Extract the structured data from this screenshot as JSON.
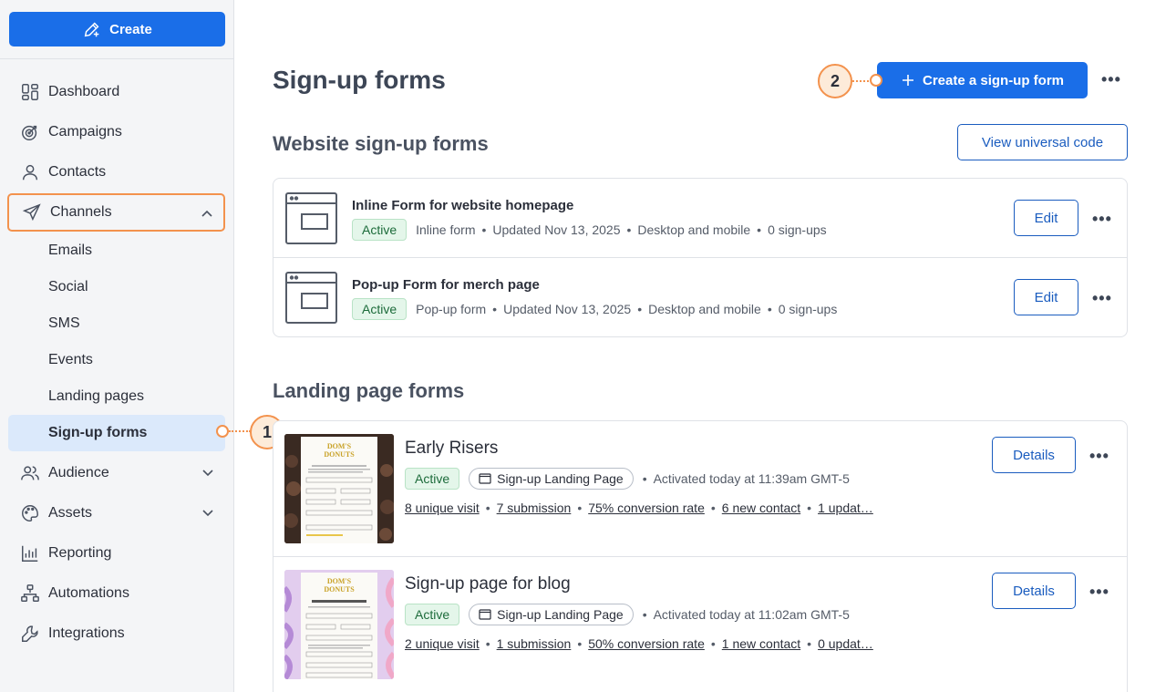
{
  "sidebar": {
    "create_label": "Create",
    "nav": [
      {
        "label": "Dashboard",
        "icon": "dashboard-icon"
      },
      {
        "label": "Campaigns",
        "icon": "target-icon"
      },
      {
        "label": "Contacts",
        "icon": "person-icon"
      },
      {
        "label": "Channels",
        "icon": "paper-plane-icon"
      }
    ],
    "channels_sub": [
      "Emails",
      "Social",
      "SMS",
      "Events",
      "Landing pages",
      "Sign-up forms"
    ],
    "nav_bottom": [
      {
        "label": "Audience",
        "icon": "people-icon"
      },
      {
        "label": "Assets",
        "icon": "palette-icon"
      },
      {
        "label": "Reporting",
        "icon": "chart-icon"
      },
      {
        "label": "Automations",
        "icon": "flow-icon"
      },
      {
        "label": "Integrations",
        "icon": "wrench-icon"
      }
    ]
  },
  "main": {
    "title": "Sign-up forms",
    "create_form_label": "Create a sign-up form",
    "website_section_title": "Website sign-up forms",
    "view_code_label": "View universal code",
    "website_forms": [
      {
        "title": "Inline Form for website homepage",
        "status": "Active",
        "type": "Inline form",
        "updated": "Updated Nov 13, 2025",
        "devices": "Desktop and mobile",
        "signups": "0 sign-ups",
        "action": "Edit"
      },
      {
        "title": "Pop-up Form for merch page",
        "status": "Active",
        "type": "Pop-up form",
        "updated": "Updated Nov 13, 2025",
        "devices": "Desktop and mobile",
        "signups": "0 sign-ups",
        "action": "Edit"
      }
    ],
    "landing_section_title": "Landing page forms",
    "landing_forms": [
      {
        "title": "Early Risers",
        "status": "Active",
        "type": "Sign-up Landing Page",
        "activated": "Activated today at 11:39am GMT-5",
        "visits": "8 unique visit",
        "submissions": "7 submission",
        "conversion": "75% conversion rate",
        "contacts": "6 new contact",
        "updates": "1 updat…",
        "action": "Details"
      },
      {
        "title": "Sign-up page for blog",
        "status": "Active",
        "type": "Sign-up Landing Page",
        "activated": "Activated today at 11:02am GMT-5",
        "visits": "2 unique visit",
        "submissions": "1 submission",
        "conversion": "50% conversion rate",
        "contacts": "1 new contact",
        "updates": "0 updat…",
        "action": "Details"
      }
    ]
  },
  "callouts": {
    "one": "1",
    "two": "2"
  },
  "thumb_brand": [
    "DOM'S",
    "DONUTS"
  ]
}
